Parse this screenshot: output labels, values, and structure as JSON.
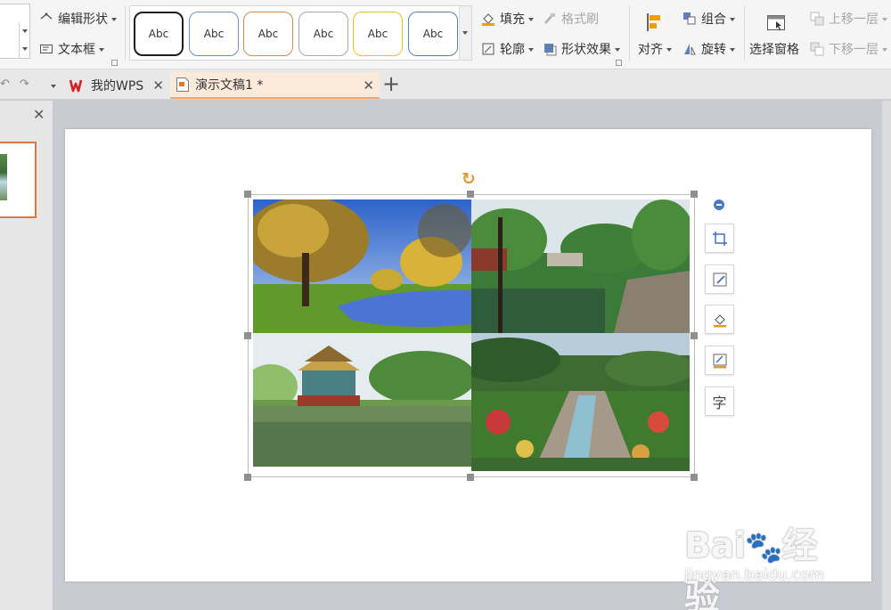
{
  "ribbon": {
    "edit_shape": "编辑形状",
    "text_box": "文本框",
    "styles": [
      {
        "label": "Abc",
        "border": "#1f1f1f"
      },
      {
        "label": "Abc",
        "border": "#6a94c3"
      },
      {
        "label": "Abc",
        "border": "#d88a4a"
      },
      {
        "label": "Abc",
        "border": "#a9a9a9"
      },
      {
        "label": "Abc",
        "border": "#e8c41a"
      },
      {
        "label": "Abc",
        "border": "#5a7fae"
      }
    ],
    "fill": "填充",
    "format_painter": "格式刷",
    "outline": "轮廓",
    "shape_effects": "形状效果",
    "align": "对齐",
    "group": "组合",
    "rotate": "旋转",
    "selection_pane": "选择窗格",
    "bring_forward": "上移一层",
    "send_backward": "下移一层"
  },
  "tabs": {
    "wps_label": "我的WPS",
    "doc_label": "演示文稿1 *"
  },
  "watermark": {
    "logo_text": "Bai du 经验",
    "url": "jingyan.baidu.com"
  }
}
